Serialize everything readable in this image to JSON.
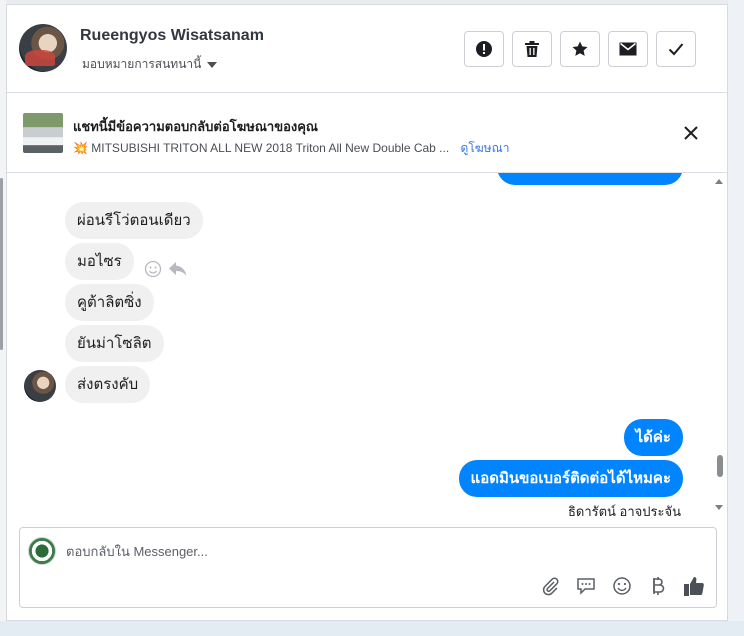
{
  "header": {
    "user_name": "Rueengyos Wisatsanam",
    "assign_label": "มอบหมายการสนทนานี้",
    "actions": [
      "alert-icon",
      "trash-icon",
      "star-icon",
      "envelope-icon",
      "check-icon"
    ]
  },
  "ad": {
    "title": "แชทนี้มีข้อความตอบกลับต่อโฆษณาของคุณ",
    "subtitle": "💥 MITSUBISHI TRITON ALL NEW 2018 Triton All New Double Cab ...",
    "link": "ดูโฆษณา"
  },
  "messages": {
    "incoming": [
      "ผ่อนรีโว่ตอนเดียว",
      "มอไซร",
      "คูต้าลิตซิ่ง",
      "ยันม่าโซลิต",
      "ส่งตรงคับ"
    ],
    "outgoing": [
      "ได้ค่ะ",
      "แอดมินขอเบอร์ติดต่อได้ไหมคะ"
    ],
    "sender_name": "ธิดารัตน์ อาจประจัน"
  },
  "composer": {
    "placeholder": "ตอบกลับใน Messenger..."
  },
  "colors": {
    "accent": "#0084ff",
    "incoming_bubble": "#f1f0f0",
    "link": "#3578e5"
  }
}
